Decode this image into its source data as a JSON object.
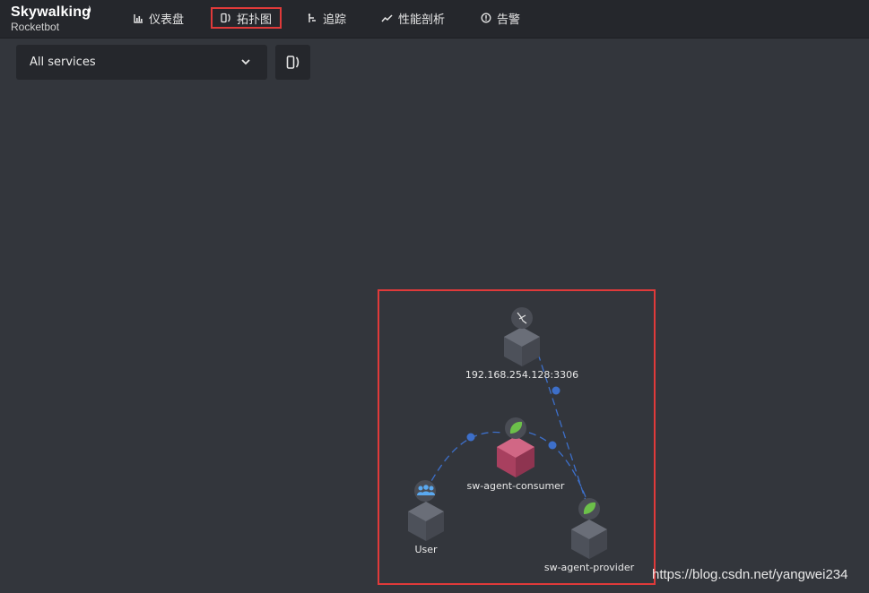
{
  "brand": {
    "name": "Skywalking",
    "product": "Rocketbot"
  },
  "nav": {
    "dashboard": "仪表盘",
    "topology": "拓扑图",
    "trace": "追踪",
    "profile": "性能剖析",
    "alarm": "告警"
  },
  "toolbar": {
    "service_select": "All services"
  },
  "topology": {
    "nodes": {
      "mysql": "192.168.254.128:3306",
      "consumer": "sw-agent-consumer",
      "user": "User",
      "provider": "sw-agent-provider"
    }
  },
  "colors": {
    "accent_box": "#e03a3a",
    "link": "#3d6fc9",
    "consumer_cube": "#b94a6a",
    "node_cube": "#5b5f69",
    "spring_leaf": "#6cc04a"
  },
  "watermark": "https://blog.csdn.net/yangwei234"
}
